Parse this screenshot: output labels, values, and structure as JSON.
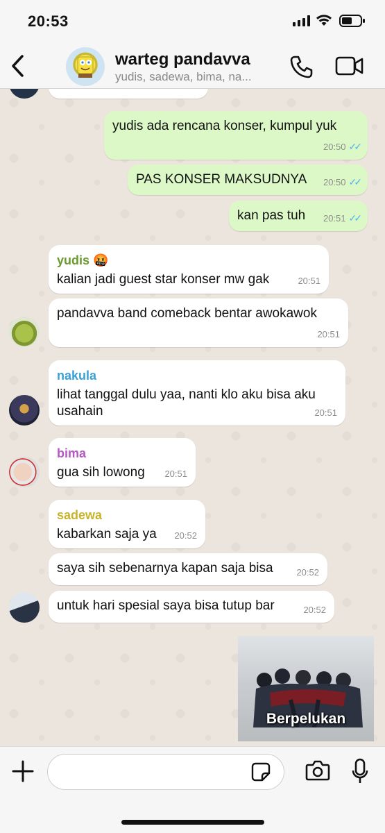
{
  "status": {
    "time": "20:53"
  },
  "header": {
    "title": "warteg pandavva",
    "subtitle": "yudis, sadewa, bima, na..."
  },
  "messages": [
    {
      "text": "yudis ada rencana konser, kumpul yuk",
      "time": "20:50"
    },
    {
      "text": "PAS KONSER MAKSUDNYA",
      "time": "20:50"
    },
    {
      "text": "kan pas tuh",
      "time": "20:51"
    },
    {
      "sender": "yudis 🤬",
      "text": "kalian jadi guest star konser mw gak",
      "time": "20:51"
    },
    {
      "text": "pandavva band comeback bentar awokawok",
      "time": "20:51"
    },
    {
      "sender": "nakula",
      "text": "lihat tanggal dulu yaa, nanti klo aku bisa aku usahain",
      "time": "20:51"
    },
    {
      "sender": "bima",
      "text": "gua sih lowong",
      "time": "20:51"
    },
    {
      "sender": "sadewa",
      "text": "kabarkan saja ya",
      "time": "20:52"
    },
    {
      "text": "saya sih sebenarnya kapan saja bisa",
      "time": "20:52"
    },
    {
      "text": "untuk hari spesial saya bisa tutup bar",
      "time": "20:52"
    }
  ],
  "sticker": {
    "label": "Berpelukan"
  },
  "input": {
    "placeholder": ""
  },
  "colors": {
    "out_bubble": "#dcf8c6",
    "in_bubble": "#ffffff",
    "read_ticks": "#4fb6ec",
    "yudis": "#6a9a2f",
    "nakula": "#3aa0d8",
    "bima": "#b557c4",
    "sadewa": "#c8b32a"
  },
  "icons": [
    "back-chevron-icon",
    "phone-icon",
    "video-camera-icon",
    "plus-icon",
    "sticker-icon",
    "camera-icon",
    "microphone-icon"
  ]
}
